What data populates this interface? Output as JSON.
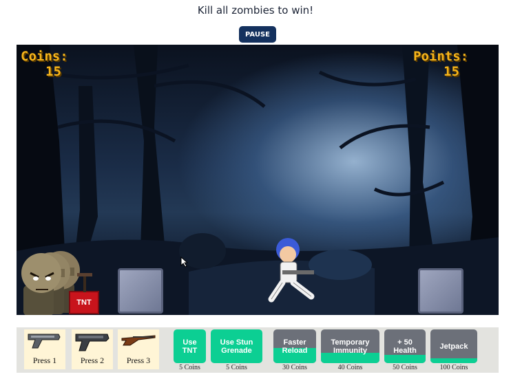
{
  "header": {
    "title": "Kill all zombies to win!",
    "pause_label": "PAUSE"
  },
  "hud": {
    "coins_label": "Coins:",
    "coins_value": "15",
    "points_label": "Points:",
    "points_value": "15"
  },
  "scene": {
    "tnt_label": "TNT"
  },
  "weapons": [
    {
      "label": "Press 1",
      "icon": "pistol-icon"
    },
    {
      "label": "Press 2",
      "icon": "heavy-pistol-icon"
    },
    {
      "label": "Press 3",
      "icon": "rifle-icon"
    }
  ],
  "shop": [
    {
      "label": "Use TNT",
      "price": "5 Coins",
      "ready": 1.0
    },
    {
      "label": "Use Stun Grenade",
      "price": "5 Coins",
      "ready": 1.0
    },
    {
      "label": "Faster Reload",
      "price": "30 Coins",
      "ready": 0.45
    },
    {
      "label": "Temporary Immunity",
      "price": "40 Coins",
      "ready": 0.3
    },
    {
      "label": "+ 50 Health",
      "price": "50 Coins",
      "ready": 0.25
    },
    {
      "label": "Jetpack",
      "price": "100 Coins",
      "ready": 0.15
    }
  ],
  "colors": {
    "accent": "#0ccf93",
    "cooldown": "#6c7079",
    "pause_bg": "#14315e",
    "hud_text": "#f7b51a"
  }
}
